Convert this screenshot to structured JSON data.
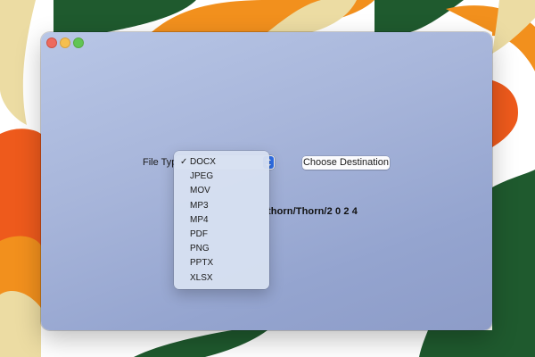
{
  "window": {
    "traffic_lights": [
      "close",
      "minimize",
      "zoom"
    ]
  },
  "form": {
    "file_type_label": "File Typ",
    "choose_destination_label": "Choose Destination",
    "destination_path": "thorn/Thorn/2 0 2 4"
  },
  "menu": {
    "selected": "DOCX",
    "items": [
      {
        "label": "DOCX",
        "checked": true
      },
      {
        "label": "JPEG",
        "checked": false
      },
      {
        "label": "MOV",
        "checked": false
      },
      {
        "label": "MP3",
        "checked": false
      },
      {
        "label": "MP4",
        "checked": false
      },
      {
        "label": "PDF",
        "checked": false
      },
      {
        "label": "PNG",
        "checked": false
      },
      {
        "label": "PPTX",
        "checked": false
      },
      {
        "label": "XLSX",
        "checked": false
      }
    ],
    "check_glyph": "✓"
  },
  "colors": {
    "wallpaper_green": "#1f5a2e",
    "wallpaper_orange": "#f2901d",
    "wallpaper_cream": "#ecdca3",
    "wallpaper_red_orange": "#ee5a1c",
    "accent_blue": "#2f6fe8"
  }
}
